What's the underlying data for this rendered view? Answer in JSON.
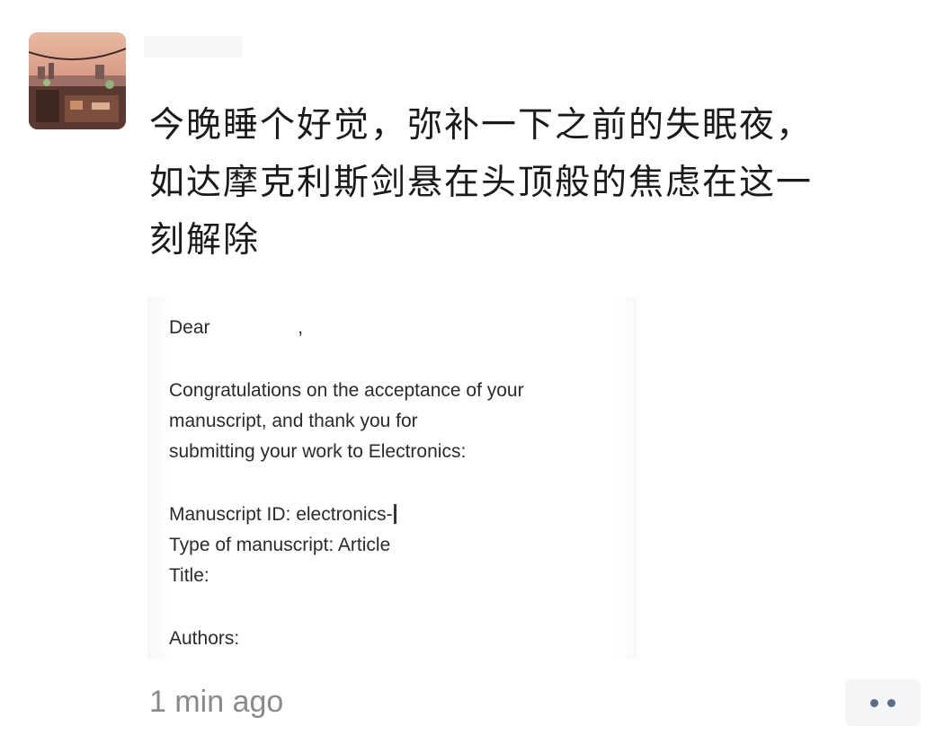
{
  "post": {
    "username": "",
    "text_lines": [
      "今晚睡个好觉，弥补一下之前的失眠夜，",
      "如达摩克利斯剑悬在头顶般的焦虑在这一",
      "刻解除"
    ],
    "timestamp": "1 min ago"
  },
  "attachment": {
    "greeting": "Dear",
    "greeting_comma": ",",
    "body_lines": [
      "Congratulations on the acceptance of your",
      "manuscript, and thank you for",
      "submitting your work to Electronics:"
    ],
    "manuscript_id_label": "Manuscript ID: electronics-",
    "type_line": "Type of manuscript: Article",
    "title_label": "Title:",
    "authors_label": "Authors:"
  },
  "actions": {
    "more_icon": "more-dots-icon"
  },
  "colors": {
    "text": "#1a1a1a",
    "timestamp": "#8a8a8a",
    "more_button_bg": "#f4f5f7",
    "more_dots": "#5b6b8c"
  }
}
